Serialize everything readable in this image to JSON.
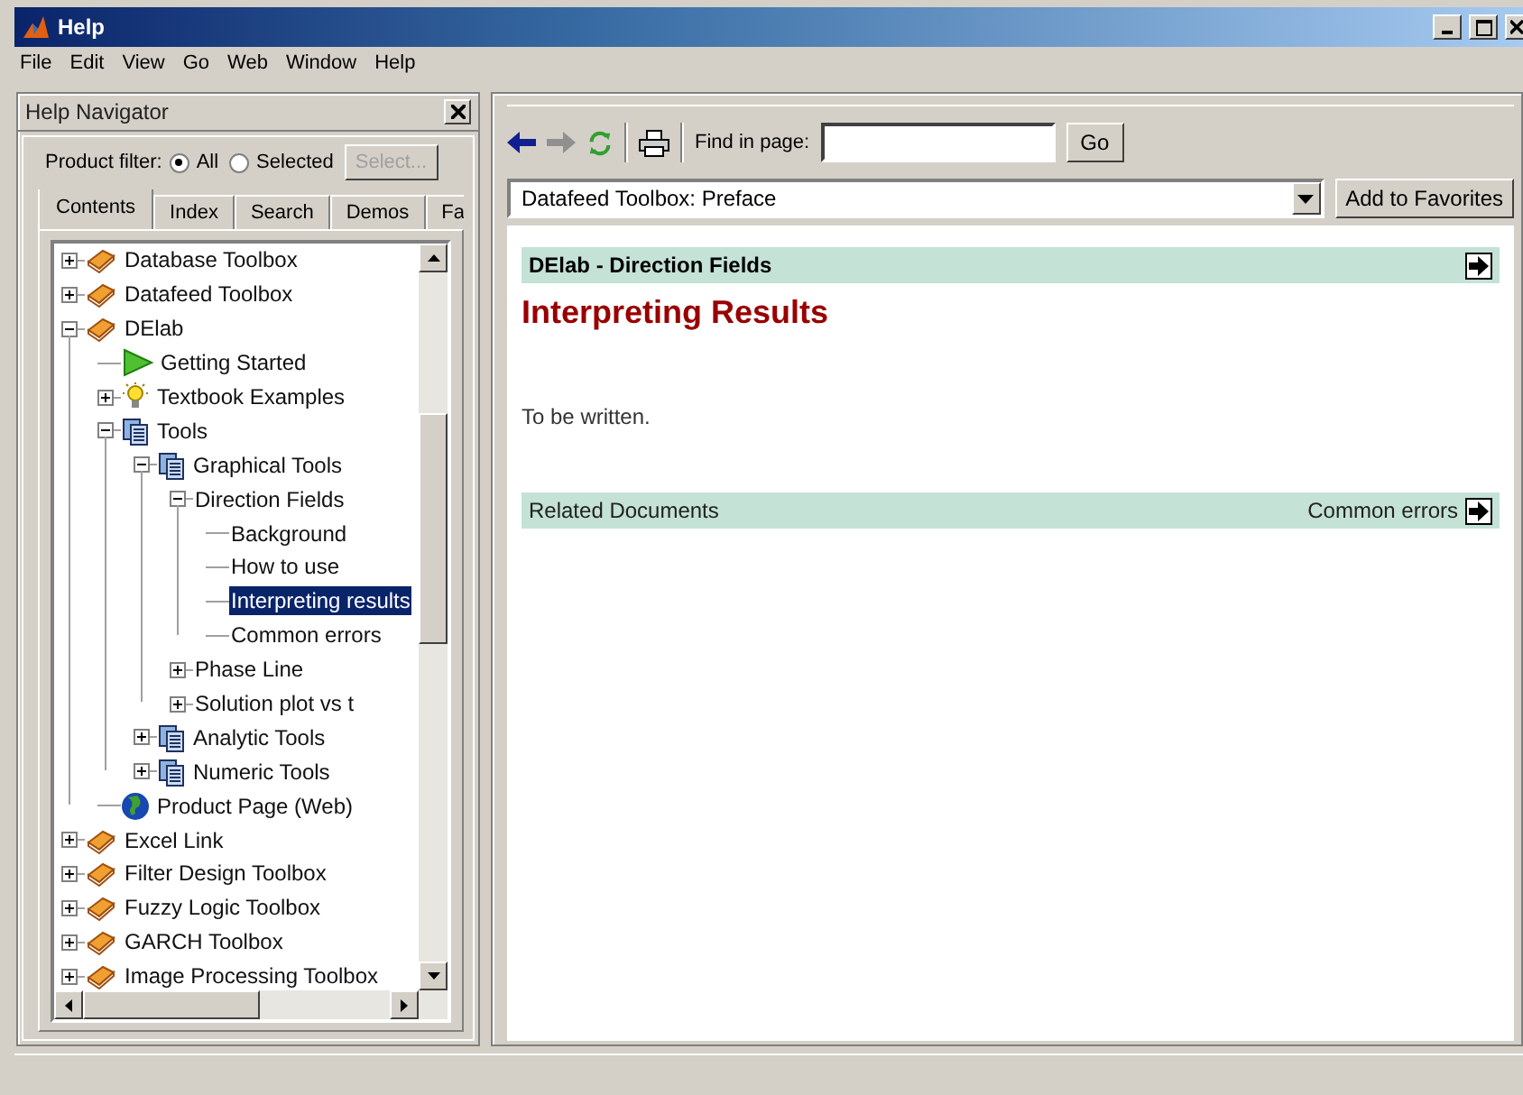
{
  "window": {
    "title": "Help"
  },
  "menu": [
    "File",
    "Edit",
    "View",
    "Go",
    "Web",
    "Window",
    "Help"
  ],
  "navigator": {
    "title": "Help Navigator",
    "filter_label": "Product filter:",
    "filter_options": [
      {
        "label": "All",
        "selected": true
      },
      {
        "label": "Selected",
        "selected": false
      }
    ],
    "select_button": {
      "label": "Select...",
      "disabled": true
    },
    "tabs": [
      {
        "label": "Contents",
        "selected": true
      },
      {
        "label": "Index",
        "selected": false
      },
      {
        "label": "Search",
        "selected": false
      },
      {
        "label": "Demos",
        "selected": false
      },
      {
        "label": "Fa",
        "selected": false
      }
    ],
    "tree": [
      {
        "label": "Database Toolbox",
        "kind": "book",
        "expanded": false,
        "selected": false
      },
      {
        "label": "Datafeed Toolbox",
        "kind": "book",
        "expanded": false,
        "selected": false
      },
      {
        "label": "DElab",
        "kind": "book",
        "expanded": true,
        "selected": false,
        "children": [
          {
            "label": "Getting Started",
            "kind": "play",
            "selected": false
          },
          {
            "label": "Textbook Examples",
            "kind": "bulb",
            "expanded": false,
            "selected": false
          },
          {
            "label": "Tools",
            "kind": "pages",
            "expanded": true,
            "selected": false,
            "children": [
              {
                "label": "Graphical Tools",
                "kind": "pages",
                "expanded": true,
                "selected": false,
                "children": [
                  {
                    "label": "Direction Fields",
                    "expanded": true,
                    "selected": false,
                    "children": [
                      {
                        "label": "Background",
                        "selected": false
                      },
                      {
                        "label": "How to use",
                        "selected": false
                      },
                      {
                        "label": "Interpreting results",
                        "selected": true
                      },
                      {
                        "label": "Common errors",
                        "selected": false
                      }
                    ]
                  },
                  {
                    "label": "Phase Line",
                    "expanded": false,
                    "selected": false
                  },
                  {
                    "label": "Solution plot vs t",
                    "expanded": false,
                    "selected": false
                  }
                ]
              },
              {
                "label": "Analytic Tools",
                "kind": "pages",
                "expanded": false,
                "selected": false
              },
              {
                "label": "Numeric Tools",
                "kind": "pages",
                "expanded": false,
                "selected": false
              }
            ]
          },
          {
            "label": "Product Page (Web)",
            "kind": "globe",
            "selected": false
          }
        ]
      },
      {
        "label": "Excel Link",
        "kind": "book",
        "expanded": false,
        "selected": false
      },
      {
        "label": "Filter Design Toolbox",
        "kind": "book",
        "expanded": false,
        "selected": false
      },
      {
        "label": "Fuzzy Logic Toolbox",
        "kind": "book",
        "expanded": false,
        "selected": false
      },
      {
        "label": "GARCH Toolbox",
        "kind": "book",
        "expanded": false,
        "selected": false
      },
      {
        "label": "Image Processing Toolbox",
        "kind": "book",
        "expanded": false,
        "selected": false
      }
    ]
  },
  "browser": {
    "find_label": "Find in page:",
    "go_button": "Go",
    "address": "Datafeed Toolbox: Preface",
    "favorites_button": "Add to Favorites",
    "page": {
      "header": "DElab - Direction Fields",
      "title": "Interpreting Results",
      "body": "To be written.",
      "related_label": "Related Documents",
      "next_link": "Common errors"
    }
  }
}
